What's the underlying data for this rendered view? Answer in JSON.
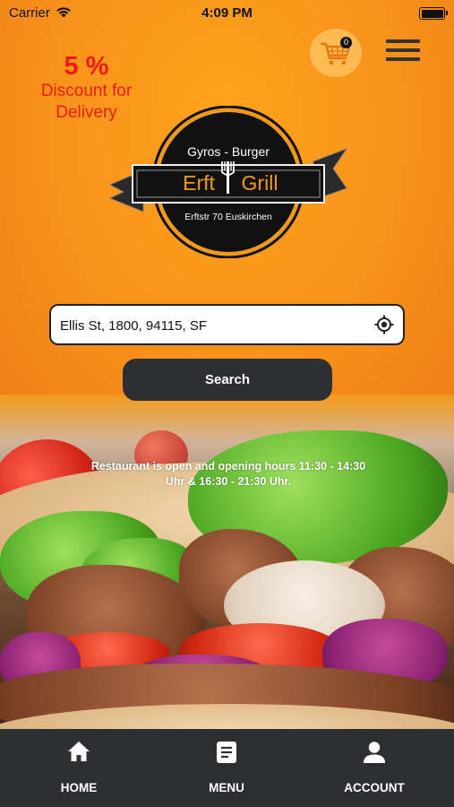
{
  "status_bar": {
    "carrier": "Carrier",
    "time": "4:09 PM"
  },
  "promo": {
    "percent": "5 %",
    "line1": "Discount for",
    "line2": "Delivery"
  },
  "cart": {
    "count": "0",
    "icon": "shopping-cart-icon"
  },
  "menu": {
    "icon": "hamburger-menu-icon"
  },
  "logo": {
    "top_text": "Gyros - Burger",
    "name_left": "Erft",
    "name_right": "Grill",
    "address": "Erftstr 70 Euskirchen"
  },
  "search": {
    "value": "Ellis St, 1800, 94115, SF",
    "placeholder": "",
    "button_label": "Search",
    "location_icon": "location-target-icon"
  },
  "hours_notice": {
    "line1": "Restaurant is open and opening hours 11:30 - 14:30",
    "line2": "Uhr & 16:30 - 21:30 Uhr."
  },
  "tab_bar": {
    "items": [
      {
        "label": "HOME",
        "icon": "home-icon"
      },
      {
        "label": "MENU",
        "icon": "menu-list-icon"
      },
      {
        "label": "ACCOUNT",
        "icon": "account-icon"
      }
    ]
  },
  "colors": {
    "accent_orange": "#f7921b",
    "discount_red": "#ec1c16",
    "dark": "#2e2f33"
  }
}
